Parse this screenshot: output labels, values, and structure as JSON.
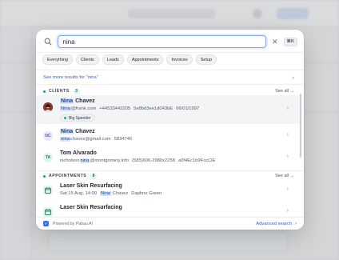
{
  "search": {
    "query": "nina",
    "shortcut": "⌘K"
  },
  "filters": [
    "Everything",
    "Clients",
    "Leads",
    "Appointments",
    "Invoices",
    "Setup"
  ],
  "see_more": {
    "prefix": "See more results for “",
    "query": "nina",
    "suffix": "”"
  },
  "clients": {
    "label": "CLIENTS",
    "count": "3",
    "see_all": "See all →",
    "items": [
      {
        "first": "Nina",
        "last": " Chavez",
        "email_hl": "Nina",
        "email_rest": "@frank.com",
        "phone": "+44533443205",
        "id": "5e8bd3ee1d043bE",
        "date": "06/01/1997",
        "badge": "Big Spender",
        "avatar_type": "photo"
      },
      {
        "initials": "NC",
        "first": "Nina",
        "last": " Chavez",
        "email_hl": "nina",
        "email_rest": "chavez@gmail.com",
        "phone": "5834746"
      },
      {
        "initials": "TA",
        "name": "Tom Alvarado",
        "email_pre": "nicholson",
        "email_hl": "nina",
        "email_rest": "@montgomery.info",
        "id": "(585)606-2980x2258",
        "code": "a0f4Ec1b9FccClE"
      }
    ]
  },
  "appointments": {
    "label": "APPOINTMENTS",
    "count": "8",
    "see_all": "See all →",
    "items": [
      {
        "title": "Laser Skin Resurfacing",
        "when": "Sat 15 Aug, 14:00",
        "client_hl": "Nina",
        "client_rest": " Chavez",
        "staff": "Daphne Green"
      },
      {
        "title": "Laser Skin Resurfacing"
      }
    ]
  },
  "footer": {
    "powered": "Powered by Pabau AI",
    "advanced": "Advanced search"
  }
}
